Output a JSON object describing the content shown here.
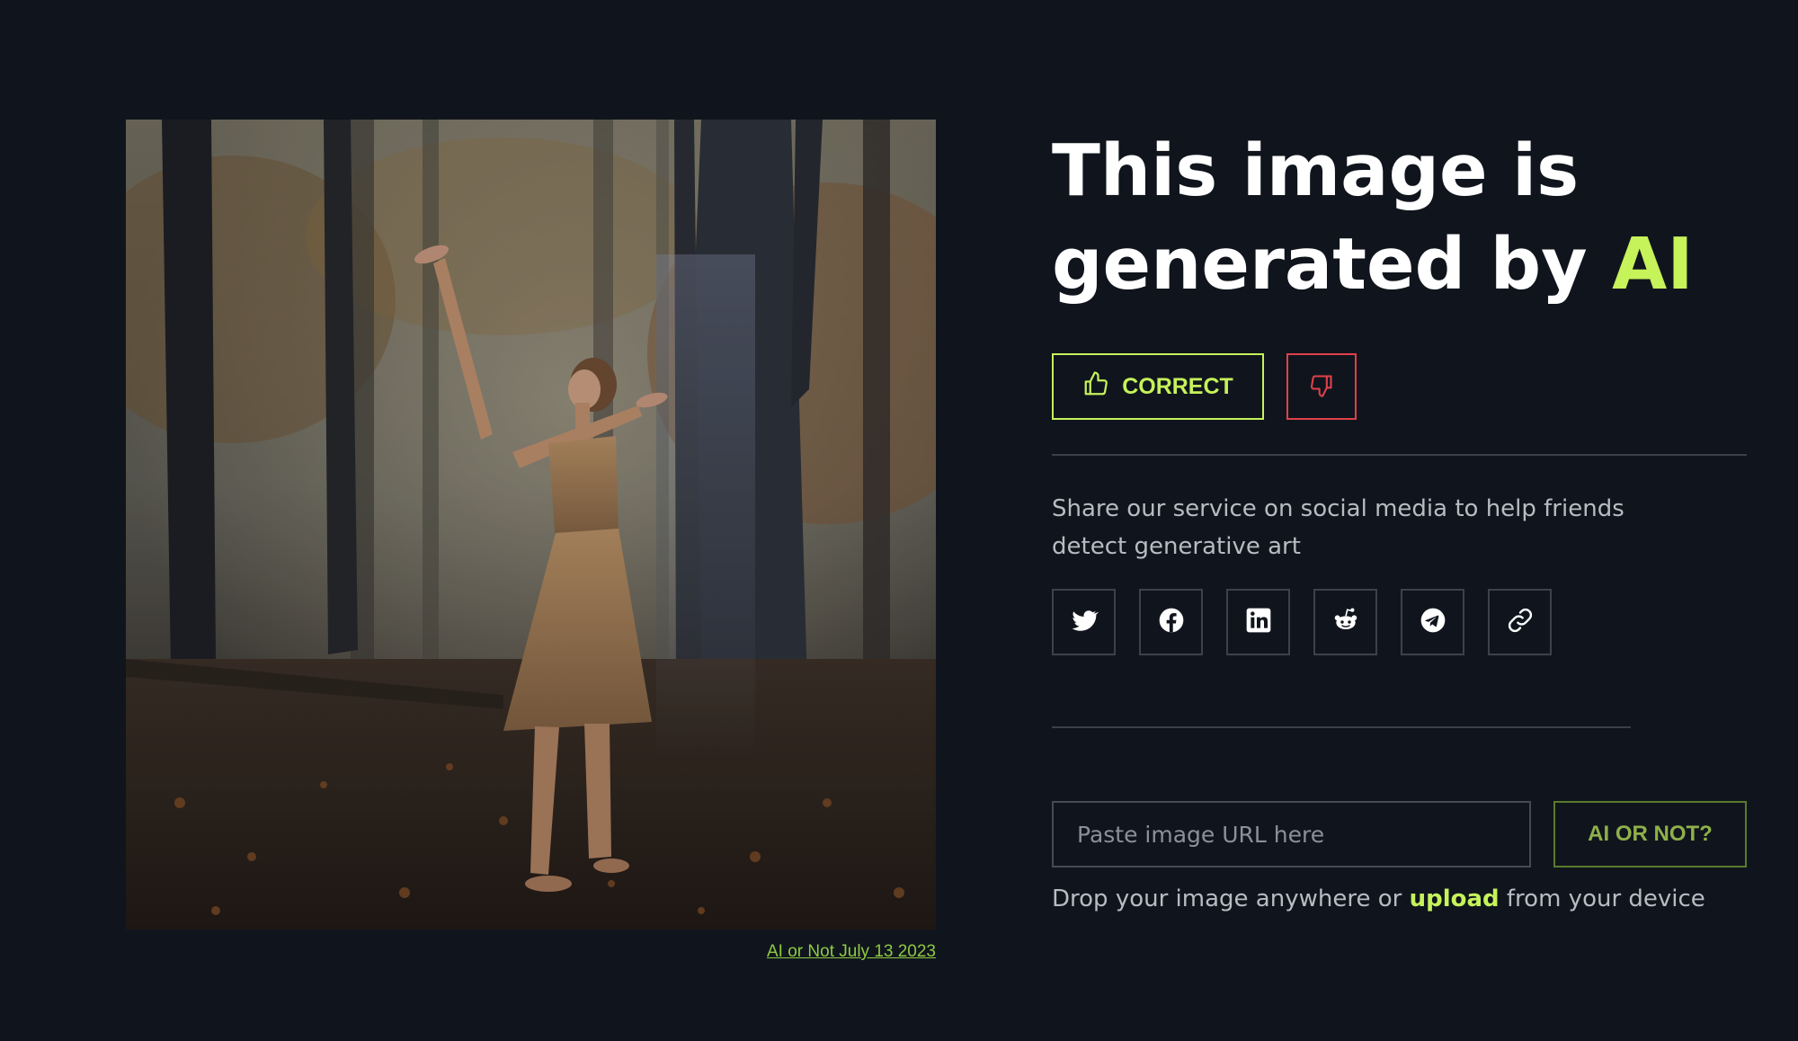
{
  "photo": {
    "alt": "Woman in a dress dancing with raised arms in a misty autumn forest"
  },
  "caption": {
    "link_text": "AI or Not July 13 2023"
  },
  "result": {
    "headline_part1": "This image is",
    "headline_part2": "generated by ",
    "headline_accent": "AI"
  },
  "feedback": {
    "correct_label": "CORRECT",
    "correct_icon": "thumbs-up-icon",
    "wrong_icon": "thumbs-down-icon"
  },
  "share": {
    "text": "Share our service on social media to help friends detect generative art",
    "networks": [
      {
        "name": "twitter",
        "icon": "twitter-icon"
      },
      {
        "name": "facebook",
        "icon": "facebook-icon"
      },
      {
        "name": "linkedin",
        "icon": "linkedin-icon"
      },
      {
        "name": "reddit",
        "icon": "reddit-icon"
      },
      {
        "name": "telegram",
        "icon": "telegram-icon"
      },
      {
        "name": "copy-link",
        "icon": "link-icon"
      }
    ]
  },
  "check": {
    "placeholder": "Paste image URL here",
    "value": "",
    "button_label": "AI OR NOT?",
    "drop_prefix": "Drop your image anywhere or ",
    "drop_link": "upload",
    "drop_suffix": " from your device"
  },
  "colors": {
    "background": "#10151d",
    "accent": "#c6f25a",
    "danger": "#e0404a",
    "muted_text": "#b7bcc3",
    "border": "#3c424b"
  }
}
